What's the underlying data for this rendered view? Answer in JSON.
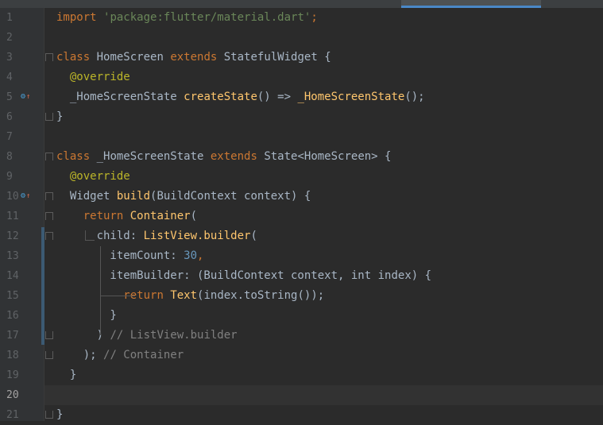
{
  "editor": {
    "current_line": 20,
    "lines": [
      {
        "num": "1",
        "tokens": [
          {
            "t": "import",
            "c": "kw"
          },
          {
            "t": " ",
            "c": "txt"
          },
          {
            "t": "'package:flutter/material.dart'",
            "c": "str"
          },
          {
            "t": ";",
            "c": "kw"
          }
        ]
      },
      {
        "num": "2",
        "tokens": []
      },
      {
        "num": "3",
        "tokens": [
          {
            "t": "class",
            "c": "kw"
          },
          {
            "t": " HomeScreen ",
            "c": "txt"
          },
          {
            "t": "extends",
            "c": "kw"
          },
          {
            "t": " StatefulWidget {",
            "c": "txt"
          }
        ]
      },
      {
        "num": "4",
        "tokens": [
          {
            "t": "  @override",
            "c": "anno"
          }
        ]
      },
      {
        "num": "5",
        "tokens": [
          {
            "t": "  _HomeScreenState ",
            "c": "txt"
          },
          {
            "t": "createState",
            "c": "fn"
          },
          {
            "t": "() => ",
            "c": "txt"
          },
          {
            "t": "_HomeScreenState",
            "c": "fn"
          },
          {
            "t": "();",
            "c": "txt"
          }
        ]
      },
      {
        "num": "6",
        "tokens": [
          {
            "t": "}",
            "c": "txt"
          }
        ]
      },
      {
        "num": "7",
        "tokens": []
      },
      {
        "num": "8",
        "tokens": [
          {
            "t": "class",
            "c": "kw"
          },
          {
            "t": " _HomeScreenState ",
            "c": "txt"
          },
          {
            "t": "extends",
            "c": "kw"
          },
          {
            "t": " State<HomeScreen> {",
            "c": "txt"
          }
        ]
      },
      {
        "num": "9",
        "tokens": [
          {
            "t": "  @override",
            "c": "anno"
          }
        ]
      },
      {
        "num": "10",
        "tokens": [
          {
            "t": "  Widget ",
            "c": "txt"
          },
          {
            "t": "build",
            "c": "fn"
          },
          {
            "t": "(BuildContext context) {",
            "c": "txt"
          }
        ]
      },
      {
        "num": "11",
        "tokens": [
          {
            "t": "    ",
            "c": "txt"
          },
          {
            "t": "return",
            "c": "kw"
          },
          {
            "t": " ",
            "c": "txt"
          },
          {
            "t": "Container",
            "c": "fn"
          },
          {
            "t": "(",
            "c": "txt"
          }
        ]
      },
      {
        "num": "12",
        "tokens": [
          {
            "t": "      child: ",
            "c": "txt"
          },
          {
            "t": "ListView.builder",
            "c": "fn"
          },
          {
            "t": "(",
            "c": "txt"
          }
        ]
      },
      {
        "num": "13",
        "tokens": [
          {
            "t": "        itemCount: ",
            "c": "txt"
          },
          {
            "t": "30",
            "c": "num"
          },
          {
            "t": ",",
            "c": "kw"
          }
        ]
      },
      {
        "num": "14",
        "tokens": [
          {
            "t": "        itemBuilder: (BuildContext context, ",
            "c": "txt"
          },
          {
            "t": "int",
            "c": "txt"
          },
          {
            "t": " index) {",
            "c": "txt"
          }
        ]
      },
      {
        "num": "15",
        "tokens": [
          {
            "t": "          ",
            "c": "txt"
          },
          {
            "t": "return",
            "c": "kw"
          },
          {
            "t": " ",
            "c": "txt"
          },
          {
            "t": "Text",
            "c": "fn"
          },
          {
            "t": "(index.toString());",
            "c": "txt"
          }
        ]
      },
      {
        "num": "16",
        "tokens": [
          {
            "t": "        }",
            "c": "txt"
          }
        ]
      },
      {
        "num": "17",
        "tokens": [
          {
            "t": "      ) ",
            "c": "txt"
          },
          {
            "t": "// ListView.builder",
            "c": "cm"
          }
        ]
      },
      {
        "num": "18",
        "tokens": [
          {
            "t": "    ); ",
            "c": "txt"
          },
          {
            "t": "// Container",
            "c": "cm"
          }
        ]
      },
      {
        "num": "19",
        "tokens": [
          {
            "t": "  }",
            "c": "txt"
          }
        ]
      },
      {
        "num": "20",
        "tokens": []
      },
      {
        "num": "21",
        "tokens": [
          {
            "t": "}",
            "c": "txt"
          }
        ]
      }
    ]
  },
  "gutter_icons": {
    "5": "override-method-icon",
    "10": "override-method-icon"
  },
  "colors": {
    "background": "#2b2b2b",
    "gutter": "#313335",
    "keyword": "#cc7832",
    "string": "#6a8759",
    "annotation": "#bbb529",
    "function": "#ffc66d",
    "number": "#6897bb",
    "comment": "#808080",
    "text": "#a9b7c6"
  }
}
